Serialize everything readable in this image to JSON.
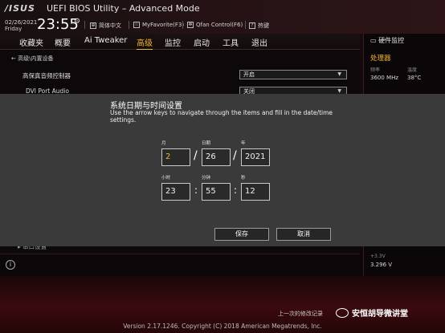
{
  "header": {
    "logo": "/ISUS",
    "title": "UEFI BIOS Utility – Advanced Mode",
    "date": "02/26/2021",
    "day": "Friday",
    "time": "23:55",
    "toolbar": [
      {
        "icon": "globe-icon",
        "label": "简体中文"
      },
      {
        "icon": "star-icon",
        "label": "MyFavorite(F3)"
      },
      {
        "icon": "fan-icon",
        "label": "Qfan Control(F6)"
      },
      {
        "icon": "help-icon",
        "label": "热键"
      }
    ]
  },
  "menu": {
    "items": [
      "收藏夹",
      "概要",
      "Ai Tweaker",
      "高级",
      "监控",
      "启动",
      "工具",
      "退出"
    ],
    "active": "高级"
  },
  "main": {
    "breadcrumb": "高级\\内置设备",
    "rows": [
      {
        "label": "高保真音频控制器",
        "value": "开启"
      },
      {
        "label": "DVI Port Audio",
        "value": "关闭"
      }
    ],
    "partial_row": "串口设置"
  },
  "hwmon": {
    "title": "硬件监控",
    "section": "处理器",
    "freq_label": "频率",
    "freq_value": "3600 MHz",
    "temp_label": "温度",
    "temp_value": "38°C",
    "v33_label": "+3.3V",
    "v33_value": "3.296 V"
  },
  "dialog": {
    "title": "系统日期与时间设置",
    "description": "Use the arrow keys to navigate through the items and fill in the date/time settings.",
    "month_label": "月",
    "day_label": "日期",
    "year_label": "年",
    "month": "2",
    "day": "26",
    "year": "2021",
    "hour_label": "小时",
    "minute_label": "分钟",
    "second_label": "秒",
    "hour": "23",
    "minute": "55",
    "second": "12",
    "save": "保存",
    "cancel": "取消"
  },
  "footer": {
    "last_modified": "上一次的修改记录",
    "version": "Version 2.17.1246. Copyright (C) 2018 American Megatrends, Inc.",
    "watermark": "安恒胡导微讲堂"
  },
  "colors": {
    "accent": "#f2b233",
    "dialog_bg": "#3a3a3a"
  }
}
